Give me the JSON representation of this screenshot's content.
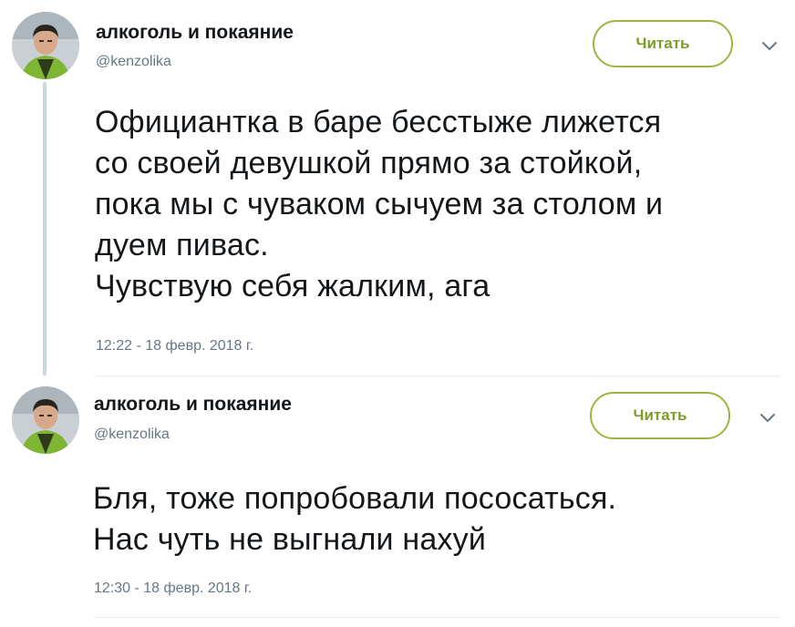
{
  "tweets": [
    {
      "display_name": "алкоголь и покаяние",
      "handle": "@kenzolika",
      "follow_label": "Читать",
      "text": "Официантка в баре бесстыже лижется\nсо своей девушкой прямо за стойкой,\nпока мы с чуваком сычуем за столом и\nдуем пивас.\nЧувствую себя жалким, ага",
      "timestamp": "12:22 - 18 февр. 2018 г."
    },
    {
      "display_name": "алкоголь и покаяние",
      "handle": "@kenzolika",
      "follow_label": "Читать",
      "text": "Бля, тоже попробовали пососаться.\nНас чуть не выгнали нахуй",
      "timestamp": "12:30 - 18 февр. 2018 г."
    }
  ],
  "colors": {
    "follow_accent": "#9fb53e",
    "secondary_text": "#657786",
    "primary_text": "#14171a",
    "thread_line": "#ccd6dd"
  },
  "icons": {
    "avatar": "avatar-photo",
    "caret": "chevron-down-icon"
  }
}
